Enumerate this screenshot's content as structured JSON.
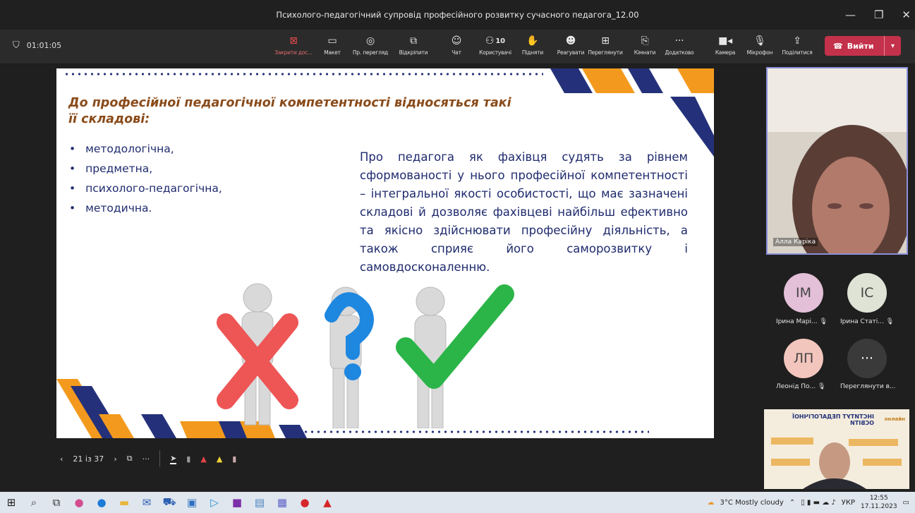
{
  "window": {
    "title": "Психолого-педагогічний супровід професійного розвитку сучасного педагога_12.00"
  },
  "meeting": {
    "elapsed": "01:01:05"
  },
  "toolbar": {
    "stop_share": "Закрити дос...",
    "layout": "Макет",
    "preview": "Пр. перегляд",
    "popout": "Відкріпити",
    "chat": "Чат",
    "participants_count": "10",
    "participants": "Користувачі",
    "raise": "Підняти",
    "react": "Реагувати",
    "view": "Переглянути",
    "rooms": "Кімнати",
    "more": "Додатково",
    "camera": "Камера",
    "mic": "Мікрофон",
    "share": "Поділитися",
    "leave": "Вийти"
  },
  "slide": {
    "title": "До професійної педагогічної компетентності відносяться такі її складові:",
    "bullets": [
      "методологічна,",
      "предметна,",
      "психолого-педагогічна,",
      "методична."
    ],
    "body": "Про педагога як фахівця судять за рівнем сформованості у нього професійної компетентності – інтегральної якості особистості, що має зазначені складові й дозволяє фахівцеві найбільш ефективно та якісно здійснювати професійну діяльність, а також сприяє його саморозвитку і самовдосконаленню."
  },
  "presenter_controls": {
    "page": "21 із 37"
  },
  "participants": {
    "main_video": "Алла Каріка",
    "p1": {
      "initials": "ІМ",
      "name": "Ірина Марі..."
    },
    "p2": {
      "initials": "ІС",
      "name": "Ірина Статі..."
    },
    "p3": {
      "initials": "ЛП",
      "name": "Леонід По..."
    },
    "p4": {
      "initials": "···",
      "name": "Переглянути в..."
    }
  },
  "small_video": {
    "heading": "ІНСТИТУТ ПЕДАГОГІЧНОЇ ОСВІТИ",
    "badge": "онлайн"
  },
  "taskbar": {
    "weather": "3°C  Mostly cloudy",
    "lang": "УКР",
    "time": "12:55",
    "date": "17.11.2023"
  },
  "colors": {
    "accent_navy": "#24317a",
    "accent_orange": "#f39a1e",
    "leave_red": "#c4314b"
  }
}
